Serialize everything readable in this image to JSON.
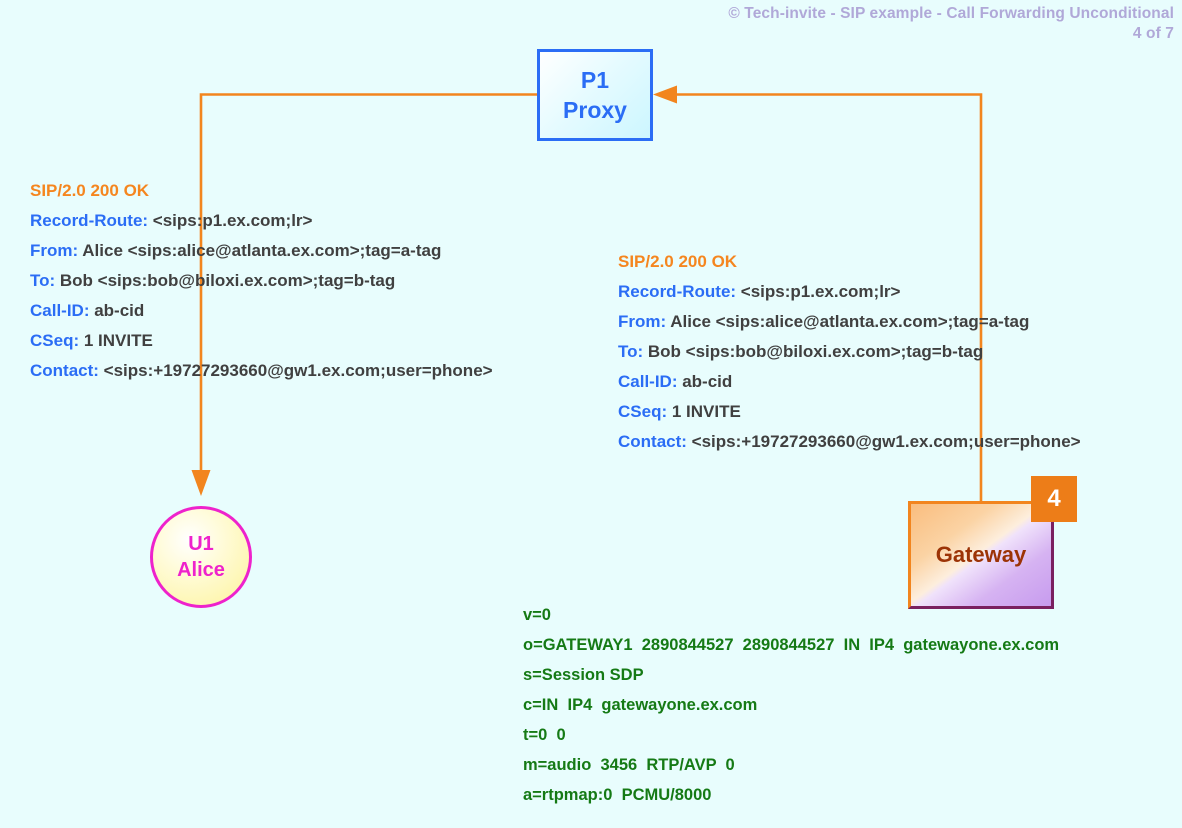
{
  "header": {
    "title": "© Tech-invite - SIP example - Call Forwarding Unconditional",
    "page": "4 of 7"
  },
  "colors": {
    "background": "#e8fdfd",
    "header_text": "#b0a8d8",
    "arrow": "#f2851e",
    "proxy_border": "#2b6df5",
    "proxy_text": "#2b6df5",
    "alice_border": "#ee22cc",
    "alice_text": "#ee22cc",
    "gateway_border_light": "#f2851e",
    "gateway_border_dark": "#7a2060",
    "gateway_text": "#9c3306",
    "badge_bg": "#ed7d18",
    "badge_text": "#ffffff",
    "sip_status": "#f5861f",
    "sip_header_name": "#2b6df5",
    "sip_header_value": "#404040",
    "sdp_text": "#157a15"
  },
  "nodes": {
    "proxy": {
      "name": "P1",
      "role": "Proxy"
    },
    "alice": {
      "name": "U1",
      "role": "Alice"
    },
    "gateway": {
      "label": "Gateway",
      "step": "4"
    }
  },
  "messages": {
    "left": {
      "status_line": "SIP/2.0 200 OK",
      "headers": [
        {
          "name": "Record-Route",
          "value": " <sips:p1.ex.com;lr>"
        },
        {
          "name": "From",
          "value": " Alice <sips:alice@atlanta.ex.com>;tag=a-tag"
        },
        {
          "name": "To",
          "value": " Bob <sips:bob@biloxi.ex.com>;tag=b-tag"
        },
        {
          "name": "Call-ID",
          "value": " ab-cid"
        },
        {
          "name": "CSeq",
          "value": " 1 INVITE"
        },
        {
          "name": "Contact",
          "value": " <sips:+19727293660@gw1.ex.com;user=phone>"
        }
      ]
    },
    "right": {
      "status_line": "SIP/2.0 200 OK",
      "headers": [
        {
          "name": "Record-Route",
          "value": " <sips:p1.ex.com;lr>"
        },
        {
          "name": "From",
          "value": " Alice <sips:alice@atlanta.ex.com>;tag=a-tag"
        },
        {
          "name": "To",
          "value": " Bob <sips:bob@biloxi.ex.com>;tag=b-tag"
        },
        {
          "name": "Call-ID",
          "value": " ab-cid"
        },
        {
          "name": "CSeq",
          "value": " 1 INVITE"
        },
        {
          "name": "Contact",
          "value": " <sips:+19727293660@gw1.ex.com;user=phone>"
        }
      ]
    }
  },
  "sdp": {
    "lines": [
      "v=0",
      "o=GATEWAY1  2890844527  2890844527  IN  IP4  gatewayone.ex.com",
      "s=Session SDP",
      "c=IN  IP4  gatewayone.ex.com",
      "t=0  0",
      "m=audio  3456  RTP/AVP  0",
      "a=rtpmap:0  PCMU/8000"
    ]
  }
}
